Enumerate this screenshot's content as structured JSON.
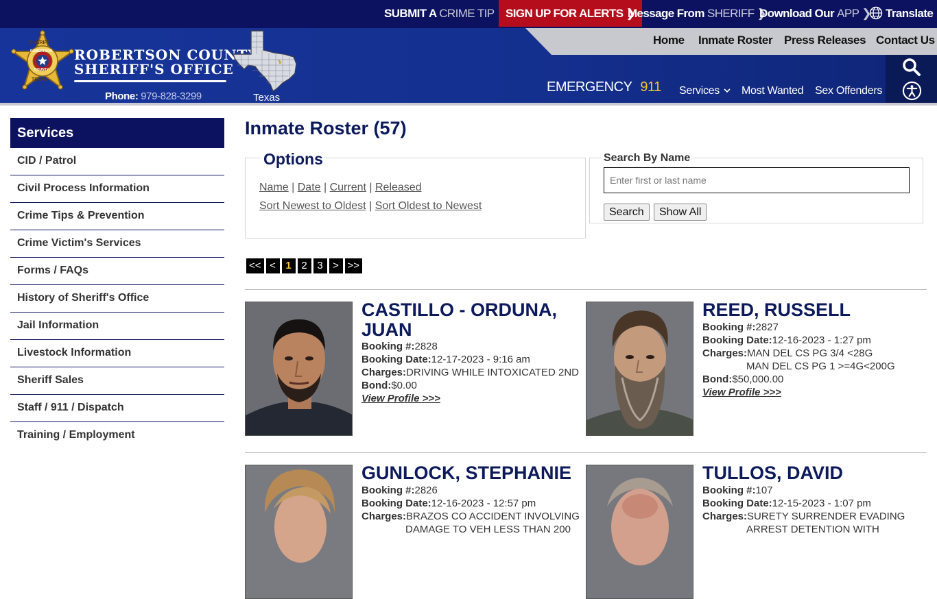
{
  "topbar": {
    "submit_prefix": "SUBMIT A ",
    "submit_highlight": "CRIME TIP",
    "alerts": "SIGN UP FOR ALERTS",
    "message_prefix": "Message From ",
    "message_highlight": "SHERIFF",
    "app_prefix": "Download Our ",
    "app_highlight": "APP",
    "translate": "Translate",
    "chevron": "❯"
  },
  "header": {
    "title_line1": "ROBERTSON COUNTY",
    "title_line2": "SHERIFF'S OFFICE",
    "phone_label": "Phone:",
    "phone_number": "979-828-3299",
    "texas_label": "Texas",
    "emergency_label": "EMERGENCY",
    "emergency_number": "911",
    "badge": {
      "top": "SHERIFF",
      "middle1": "ROBERTSON",
      "middle2": "COUNTY",
      "bottom": "TEXAS"
    },
    "icons": {
      "search": "search-icon",
      "accessibility": "accessibility-icon",
      "globe": "globe-icon"
    }
  },
  "mainnav": [
    "Home",
    "Inmate Roster",
    "Press Releases",
    "Contact Us"
  ],
  "subnav": {
    "services": "Services",
    "most_wanted": "Most Wanted",
    "sex_offenders": "Sex Offenders",
    "caret": "⌄"
  },
  "sidebar": {
    "heading": "Services",
    "items": [
      "CID / Patrol",
      "Civil Process Information",
      "Crime Tips & Prevention",
      "Crime Victim's Services",
      "Forms / FAQs",
      "History of Sheriff's Office",
      "Jail Information",
      "Livestock Information",
      "Sheriff Sales",
      "Staff / 911 / Dispatch",
      "Training / Employment"
    ]
  },
  "main": {
    "title": "Inmate Roster (57)",
    "options": {
      "legend": "Options",
      "sort_links": [
        "Name",
        "Date",
        "Current",
        "Released"
      ],
      "order_links": [
        "Sort Newest to Oldest",
        "Sort Oldest to Newest"
      ],
      "separator": " | "
    },
    "search": {
      "legend": "Search By Name",
      "placeholder": "Enter first or last name",
      "value": "",
      "search_button": "Search",
      "show_all_button": "Show All"
    },
    "pager": {
      "first": "<<",
      "prev": "<",
      "pages": [
        "1",
        "2",
        "3"
      ],
      "current": "1",
      "next": ">",
      "last": ">>"
    }
  },
  "labels": {
    "booking_no": "Booking #:",
    "booking_date": "Booking Date:",
    "charges": "Charges:",
    "bond": "Bond:",
    "view_profile": "View Profile >>>"
  },
  "inmates": [
    {
      "name": "CASTILLO - ORDUNA, JUAN",
      "booking_no": "2828",
      "booking_date": "12-17-2023 - 9:16 am",
      "charges": [
        "DRIVING WHILE INTOXICATED 2ND"
      ],
      "bond": "$0.00"
    },
    {
      "name": "REED, RUSSELL",
      "booking_no": "2827",
      "booking_date": "12-16-2023 - 1:27 pm",
      "charges": [
        "MAN DEL CS PG 3/4 <28G",
        "MAN DEL CS PG 1 >=4G<200G"
      ],
      "bond": "$50,000.00"
    },
    {
      "name": "GUNLOCK, STEPHANIE",
      "booking_no": "2826",
      "booking_date": "12-16-2023 - 12:57 pm",
      "charges": [
        "BRAZOS CO ACCIDENT INVOLVING",
        "DAMAGE TO VEH LESS THAN 200"
      ]
    },
    {
      "name": "TULLOS, DAVID",
      "booking_no": "107",
      "booking_date": "12-15-2023 - 1:07 pm",
      "charges": [
        "SURETY SURRENDER EVADING",
        "ARREST DETENTION WITH"
      ]
    }
  ],
  "colors": {
    "navy": "#0c1260",
    "alert_red": "#b50d1b",
    "gold": "#f4c430",
    "header_blue": "#16308e"
  }
}
